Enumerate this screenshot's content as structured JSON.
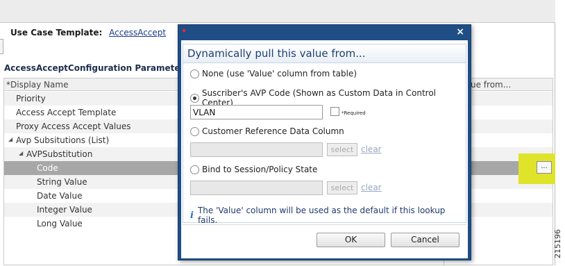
{
  "page": {
    "template_label": "Use Case Template:",
    "template_link": "AccessAccept",
    "section_title": "AccessAcceptConfiguration Parameters",
    "figure_id": "215196"
  },
  "table": {
    "col_display_name": "*Display Name",
    "col_value_partial": "ue from...",
    "rows": [
      {
        "label": "Priority",
        "level": 1,
        "selected": false,
        "alt": true
      },
      {
        "label": "Access Accept Template",
        "level": 1,
        "selected": false,
        "alt": false
      },
      {
        "label": "Proxy Access Accept Values",
        "level": 1,
        "selected": false,
        "alt": true
      },
      {
        "label": "Avp Subsitutions (List)",
        "level": 1,
        "expanded": true,
        "selected": false,
        "alt": false
      },
      {
        "label": "AVPSubstitution",
        "level": 2,
        "expanded": true,
        "selected": false,
        "alt": true
      },
      {
        "label": "Code",
        "level": 3,
        "selected": true,
        "alt": false
      },
      {
        "label": "String Value",
        "level": 3,
        "selected": false,
        "alt": true
      },
      {
        "label": "Date Value",
        "level": 3,
        "selected": false,
        "alt": false
      },
      {
        "label": "Integer Value",
        "level": 3,
        "selected": false,
        "alt": true
      },
      {
        "label": "Long Value",
        "level": 3,
        "selected": false,
        "alt": false
      }
    ],
    "ellipsis_button": "...",
    "highlight_color": "#dfe42a"
  },
  "dialog": {
    "close_icon": "×",
    "heading": "Dynamically pull this value from...",
    "options": {
      "none": "None (use 'Value' column from table)",
      "avp_code": "Suscriber's AVP Code (Shown as Custom Data in Control Center)",
      "crd_column": "Customer Reference Data Column",
      "session_state": "Bind to Session/Policy State"
    },
    "selected_option": "avp_code",
    "avp_code_value": "VLAN",
    "required_label": "*Required",
    "select_label": "select",
    "clear_label": "clear",
    "note": "The 'Value' column will be used as the default if this lookup fails.",
    "ok_label": "OK",
    "cancel_label": "Cancel",
    "title_color": "#1f4e86"
  }
}
